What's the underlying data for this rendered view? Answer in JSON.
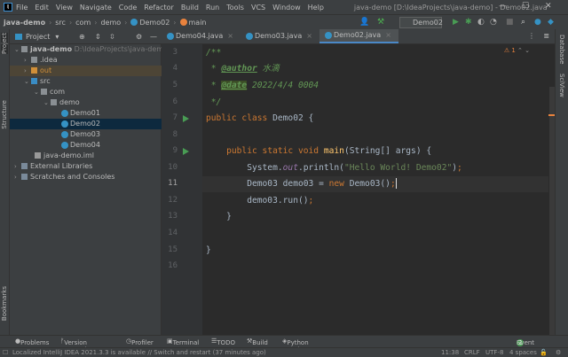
{
  "title": {
    "menu": [
      "File",
      "Edit",
      "View",
      "Navigate",
      "Code",
      "Refactor",
      "Build",
      "Run",
      "Tools",
      "VCS",
      "Window",
      "Help"
    ],
    "window_title": "java-demo [D:\\IdeaProjects\\java-demo] - Demo02.java"
  },
  "nav": {
    "crumbs": [
      "java-demo",
      "src",
      "com",
      "demo",
      "Demo02",
      "main"
    ],
    "run_config": "Demo02"
  },
  "project_panel": {
    "title": "Project",
    "tree": [
      {
        "label": "java-demo",
        "hint": "D:\\IdeaProjects\\java-demo",
        "depth": 0
      },
      {
        "label": ".idea",
        "depth": 1
      },
      {
        "label": "out",
        "depth": 1
      },
      {
        "label": "src",
        "depth": 1
      },
      {
        "label": "com",
        "depth": 2
      },
      {
        "label": "demo",
        "depth": 3
      },
      {
        "label": "Demo01",
        "depth": 4
      },
      {
        "label": "Demo02",
        "depth": 4
      },
      {
        "label": "Demo03",
        "depth": 4
      },
      {
        "label": "Demo04",
        "depth": 4
      },
      {
        "label": "java-demo.iml",
        "depth": 1
      },
      {
        "label": "External Libraries",
        "depth": 0
      },
      {
        "label": "Scratches and Consoles",
        "depth": 0
      }
    ]
  },
  "tabs": [
    "Demo04.java",
    "Demo03.java",
    "Demo02.java"
  ],
  "editor": {
    "line_numbers": [
      "3",
      "4",
      "5",
      "6",
      "7",
      "8",
      "9",
      "10",
      "11",
      "12",
      "13",
      "14",
      "15",
      "16"
    ],
    "current_line": "11",
    "warnings": "1",
    "author": "水滴",
    "date": "2022/4/4 0004",
    "hello": "\"Hello World! Demo02\""
  },
  "left_stripe": [
    "Project",
    "Structure",
    "Bookmarks"
  ],
  "right_stripe": [
    "Database",
    "SciView"
  ],
  "bottom_tools": [
    "Problems",
    "Version Control",
    "Profiler",
    "Terminal",
    "TODO",
    "Build",
    "Python Packages"
  ],
  "event_log": {
    "label": "Event Log",
    "count": "2"
  },
  "status": {
    "message": "Localized IntelliJ IDEA 2021.3.3 is available // Switch and restart (37 minutes ago)",
    "position": "11:38",
    "line_sep": "CRLF",
    "encoding": "UTF-8",
    "indent": "4 spaces"
  }
}
